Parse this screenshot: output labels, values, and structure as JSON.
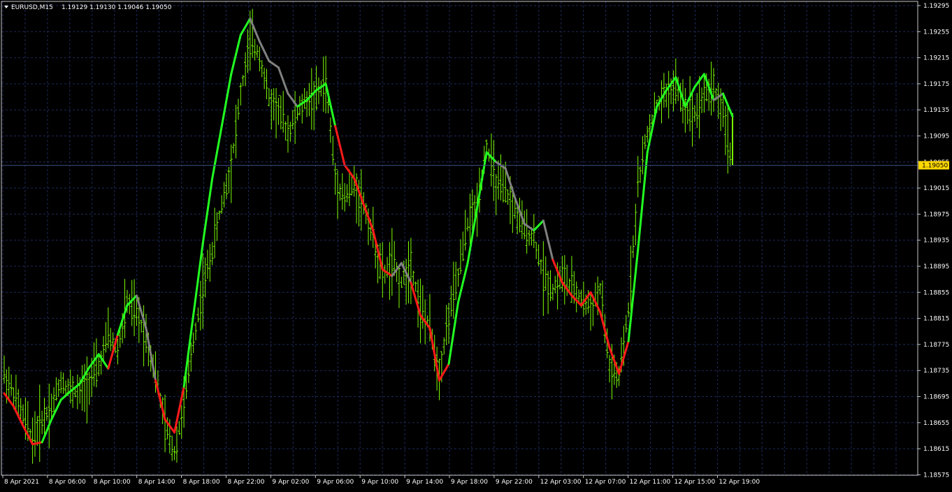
{
  "header": {
    "symbol": "EURUSD,M15",
    "ohlc": "1.19129 1.19130 1.19046 1.19050"
  },
  "colors": {
    "background": "#000000",
    "frame": "#c8c8c8",
    "grid": "#1e2a5a",
    "bars": "#7cfc00",
    "ma_up": "#22ff22",
    "ma_down": "#ff1a1a",
    "ma_flat": "#808080",
    "price_tag_bg": "#ffd800",
    "price_line": "#3a4a7a"
  },
  "price_tag": "1.19050",
  "chart_data": {
    "type": "line",
    "symbol": "EURUSD",
    "timeframe": "M15",
    "grid": true,
    "ylim": [
      1.18655,
      1.19295
    ],
    "y_ticks": [
      "1.19295",
      "1.19255",
      "1.19215",
      "1.19175",
      "1.19135",
      "1.19095",
      "1.19055",
      "1.19015",
      "1.18975",
      "1.18935",
      "1.18895",
      "1.18855",
      "1.18815",
      "1.18775",
      "1.18735",
      "1.18695",
      "1.18655",
      "1.18615",
      "1.18575"
    ],
    "x_ticks": [
      "8 Apr 2021",
      "8 Apr 06:00",
      "8 Apr 10:00",
      "8 Apr 14:00",
      "8 Apr 18:00",
      "8 Apr 22:00",
      "9 Apr 02:00",
      "9 Apr 06:00",
      "9 Apr 10:00",
      "9 Apr 14:00",
      "9 Apr 18:00",
      "9 Apr 22:00",
      "12 Apr 03:00",
      "12 Apr 07:00",
      "12 Apr 11:00",
      "12 Apr 15:00",
      "12 Apr 19:00"
    ],
    "last_price": 1.1905,
    "closes": [
      1.1873,
      1.187,
      1.18665,
      1.1863,
      1.1866,
      1.1868,
      1.1872,
      1.18705,
      1.187,
      1.1872,
      1.1874,
      1.1879,
      1.18765,
      1.1884,
      1.1882,
      1.1879,
      1.1873,
      1.1865,
      1.1861,
      1.1868,
      1.1878,
      1.1886,
      1.1892,
      1.1899,
      1.1905,
      1.1916,
      1.1924,
      1.1922,
      1.1915,
      1.19135,
      1.191,
      1.1913,
      1.1915,
      1.19155,
      1.1918,
      1.1903,
      1.19,
      1.1902,
      1.1899,
      1.1894,
      1.1888,
      1.189,
      1.1887,
      1.189,
      1.1883,
      1.188,
      1.1873,
      1.1882,
      1.1888,
      1.1896,
      1.1899,
      1.1908,
      1.1902,
      1.1901,
      1.1898,
      1.1895,
      1.1894,
      1.1888,
      1.1886,
      1.1888,
      1.1886,
      1.18845,
      1.1883,
      1.1886,
      1.1874,
      1.1872,
      1.1883,
      1.1902,
      1.191,
      1.1914,
      1.1916,
      1.1917,
      1.1914,
      1.1913,
      1.1916,
      1.1917,
      1.1913,
      1.1905
    ],
    "ma": {
      "values": [
        1.187,
        1.1868,
        1.1865,
        1.18622,
        1.18625,
        1.1866,
        1.1869,
        1.18703,
        1.18715,
        1.1874,
        1.1876,
        1.18738,
        1.1879,
        1.18835,
        1.1885,
        1.188,
        1.1872,
        1.1866,
        1.1864,
        1.1871,
        1.1882,
        1.1893,
        1.1903,
        1.1911,
        1.1919,
        1.1925,
        1.19275,
        1.1924,
        1.1921,
        1.192,
        1.1916,
        1.1914,
        1.1915,
        1.19165,
        1.19175,
        1.1911,
        1.1905,
        1.1903,
        1.1899,
        1.1895,
        1.1889,
        1.1888,
        1.189,
        1.1887,
        1.1882,
        1.188,
        1.1872,
        1.18745,
        1.1884,
        1.189,
        1.18985,
        1.1907,
        1.19055,
        1.19045,
        1.19,
        1.1896,
        1.1895,
        1.18965,
        1.18905,
        1.1887,
        1.1885,
        1.18835,
        1.18855,
        1.18825,
        1.1877,
        1.1873,
        1.1878,
        1.1892,
        1.1907,
        1.1914,
        1.19165,
        1.19185,
        1.1914,
        1.1917,
        1.1919,
        1.1915,
        1.1916,
        1.19125
      ],
      "colors": [
        "down",
        "down",
        "down",
        "down",
        "up",
        "up",
        "up",
        "up",
        "up",
        "up",
        "up",
        "down",
        "up",
        "up",
        "flat",
        "flat",
        "down",
        "down",
        "down",
        "up",
        "up",
        "up",
        "up",
        "up",
        "up",
        "up",
        "flat",
        "flat",
        "flat",
        "flat",
        "flat",
        "up",
        "up",
        "up",
        "up",
        "down",
        "down",
        "down",
        "down",
        "down",
        "down",
        "flat",
        "flat",
        "down",
        "down",
        "down",
        "down",
        "up",
        "up",
        "up",
        "up",
        "up",
        "flat",
        "flat",
        "flat",
        "flat",
        "up",
        "flat",
        "down",
        "down",
        "down",
        "down",
        "down",
        "down",
        "down",
        "down",
        "up",
        "up",
        "up",
        "up",
        "up",
        "up",
        "up",
        "up",
        "up",
        "flat",
        "up",
        "flat"
      ]
    }
  }
}
